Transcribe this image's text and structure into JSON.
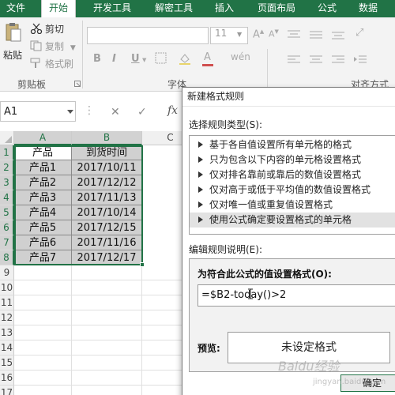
{
  "ribbon": {
    "tabs": [
      {
        "label": "文件"
      },
      {
        "label": "开始"
      },
      {
        "label": "开发工具"
      },
      {
        "label": "解密工具"
      },
      {
        "label": "插入"
      },
      {
        "label": "页面布局"
      },
      {
        "label": "公式"
      },
      {
        "label": "数据"
      }
    ],
    "paste_label": "粘贴",
    "cut_label": "剪切",
    "copy_label": "复制",
    "format_painter_label": "格式刷",
    "clipboard_group": "剪贴板",
    "font_size": "11",
    "font_group": "字体",
    "align_group": "对齐方式",
    "bold": "B",
    "italic": "I",
    "underline": "U",
    "strike": "A",
    "accent_color": "#217346"
  },
  "formula_bar": {
    "name_box": "A1",
    "cancel": "✕",
    "enter": "✓",
    "fx": "fx"
  },
  "sheet": {
    "columns": [
      "A",
      "B",
      "C"
    ],
    "rows": [
      "1",
      "2",
      "3",
      "4",
      "5",
      "6",
      "7",
      "8",
      "9",
      "10",
      "11",
      "12",
      "13",
      "14",
      "15",
      "16",
      "17"
    ],
    "header": [
      "产品",
      "到货时间"
    ],
    "data": [
      [
        "产品1",
        "2017/10/11"
      ],
      [
        "产品2",
        "2017/12/12"
      ],
      [
        "产品3",
        "2017/11/13"
      ],
      [
        "产品4",
        "2017/10/14"
      ],
      [
        "产品5",
        "2017/12/15"
      ],
      [
        "产品6",
        "2017/11/16"
      ],
      [
        "产品7",
        "2017/12/17"
      ]
    ]
  },
  "dialog": {
    "title": "新建格式规则",
    "rule_type_label": "选择规则类型(S):",
    "rule_types": [
      "基于各自值设置所有单元格的格式",
      "只为包含以下内容的单元格设置格式",
      "仅对排名靠前或靠后的数值设置格式",
      "仅对高于或低于平均值的数值设置格式",
      "仅对唯一值或重复值设置格式",
      "使用公式确定要设置格式的单元格"
    ],
    "selected_rule_index": 5,
    "edit_desc_label": "编辑规则说明(E):",
    "formula_heading": "为符合此公式的值设置格式(O):",
    "formula_value_before_cursor": "=$B2-tod",
    "formula_value_after_cursor": "ay()>2",
    "preview_label": "预览:",
    "preview_text": "未设定格式",
    "ok_label": "确定"
  },
  "watermark": {
    "text": "Baidu经验",
    "url": "jingyan.baidu.com"
  }
}
